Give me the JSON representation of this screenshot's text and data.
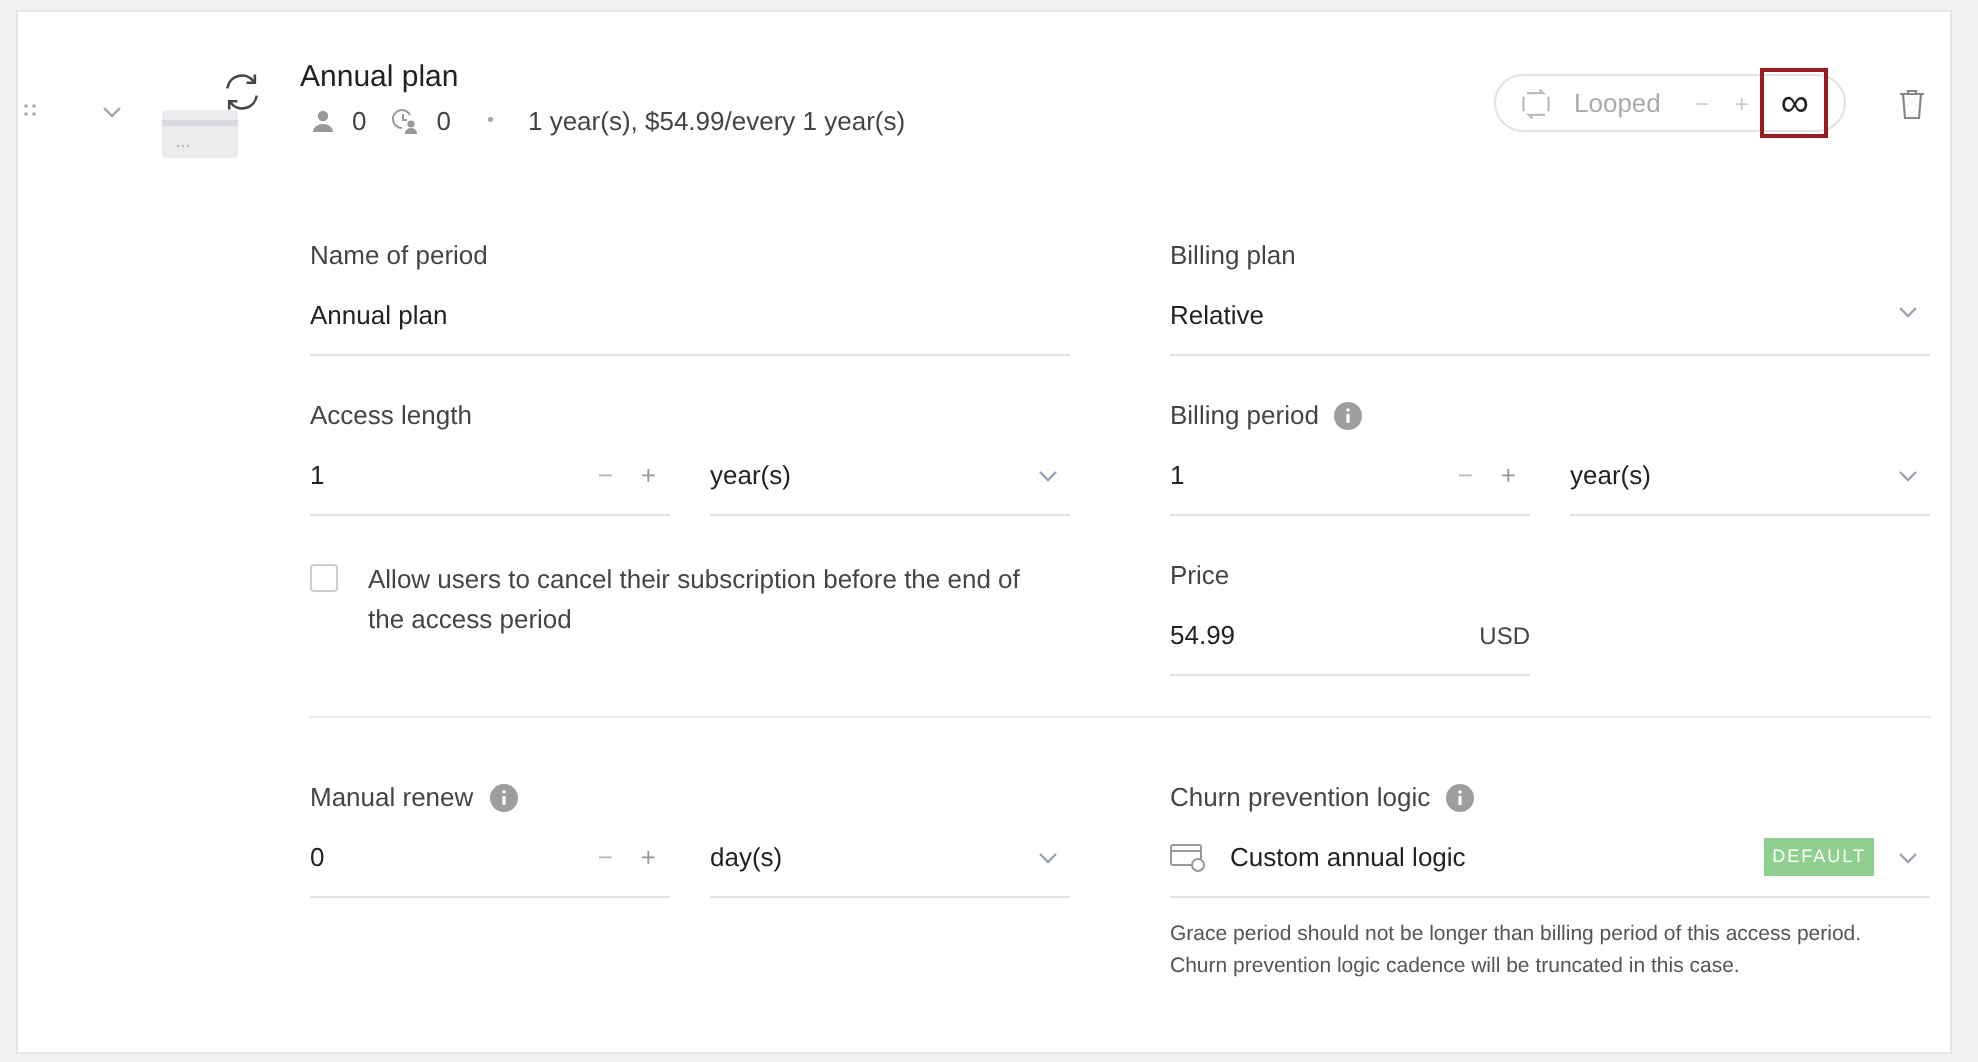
{
  "header": {
    "title": "Annual plan",
    "subscribers": "0",
    "trials": "0",
    "separator": "•",
    "summary": "1 year(s), $54.99/every 1 year(s)"
  },
  "loop_control": {
    "label": "Looped",
    "minus": "−",
    "plus": "+",
    "infinity": "∞",
    "infinity_selected": true
  },
  "left": [
    {
      "kind": "text",
      "label": "Name of period",
      "value": "Annual plan"
    },
    {
      "kind": "stepper",
      "label": "Access length",
      "value": "1",
      "minus": "−",
      "plus": "+",
      "unit": "year(s)"
    },
    {
      "kind": "checkbox",
      "label": "Allow users to cancel their subscription before the end of the access period",
      "checked": false
    }
  ],
  "right": [
    {
      "kind": "select",
      "label": "Billing plan",
      "value": "Relative"
    },
    {
      "kind": "stepper",
      "label": "Billing period",
      "info": true,
      "value": "1",
      "minus": "−",
      "plus": "+",
      "unit": "year(s)"
    },
    {
      "kind": "price",
      "label": "Price",
      "value": "54.99",
      "currency": "USD"
    }
  ],
  "bottom_left": {
    "kind": "stepper",
    "label": "Manual renew",
    "info": true,
    "value": "0",
    "minus": "−",
    "plus": "+",
    "unit": "day(s)"
  },
  "bottom_right": {
    "label": "Churn prevention logic",
    "info": true,
    "value": "Custom annual logic",
    "badge": "DEFAULT",
    "note": "Grace period should not be longer than billing period of this access period. Churn prevention logic cadence will be truncated in this case."
  }
}
